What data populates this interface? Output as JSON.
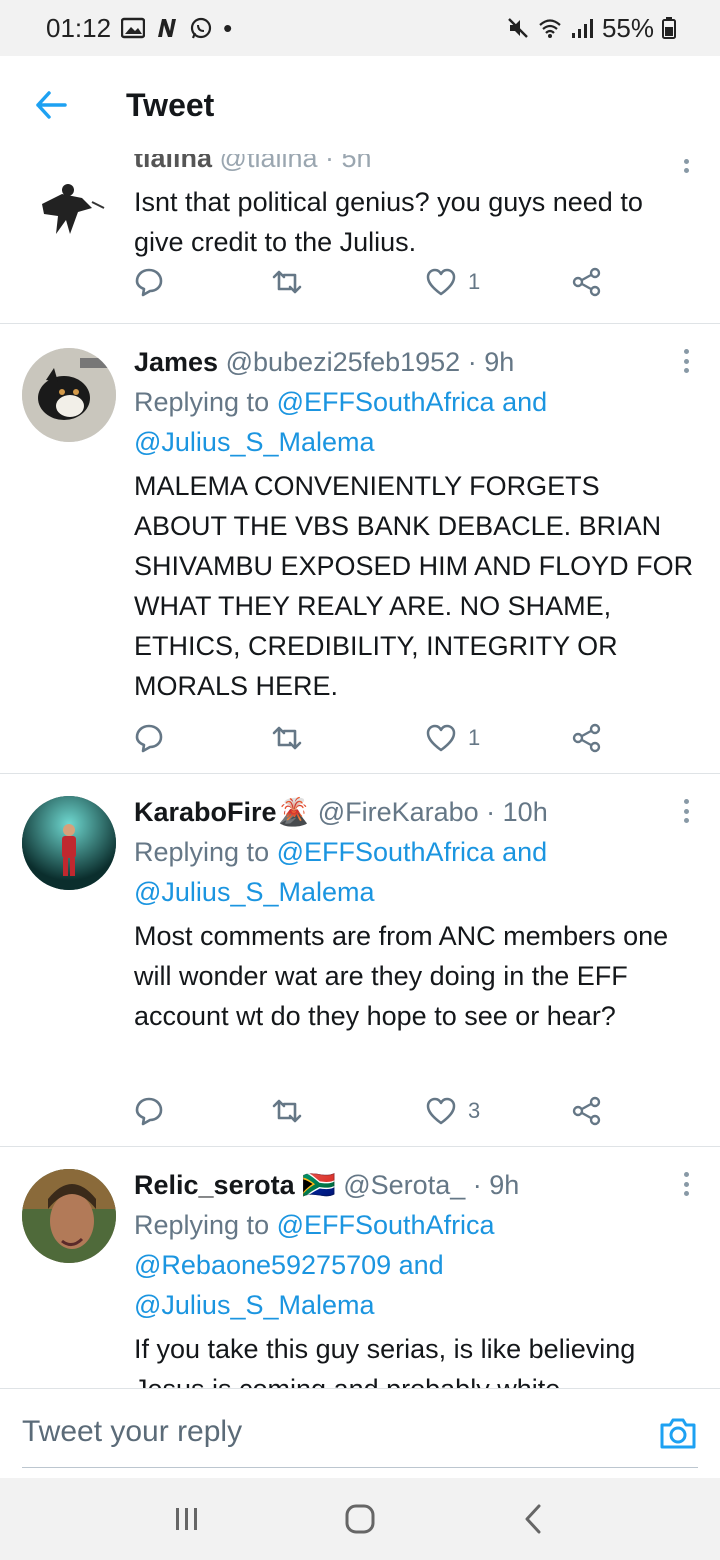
{
  "status_bar": {
    "time": "01:12",
    "dot": "•",
    "battery": "55%",
    "icons": [
      "gallery-icon",
      "n-icon",
      "whatsapp-icon",
      "mute-icon",
      "wifi-icon",
      "signal-icon",
      "battery-icon"
    ]
  },
  "header": {
    "title": "Tweet",
    "back_icon": "arrow-left-icon",
    "accent": "#1da1f2"
  },
  "tweets": [
    {
      "name": "tlallna",
      "handle": "@tlallna",
      "time": " · 5h",
      "text": "Isnt that political genius? you guys need to give credit to the Julius.",
      "likes": "1",
      "cut_off_top": true
    },
    {
      "name": "James",
      "handle": "@bubezi25feb1952",
      "time": " · 9h",
      "reply_prefix": "Replying to ",
      "reply_to_1": "@EFFSouthAfrica",
      "reply_joiner_1": " and",
      "reply_to_2": "@Julius_S_Malema",
      "text": "MALEMA CONVENIENTLY FORGETS ABOUT THE VBS BANK DEBACLE. BRIAN SHIVAMBU EXPOSED HIM AND FLOYD FOR WHAT THEY REALY ARE. NO SHAME, ETHICS, CREDIBILITY, INTEGRITY OR MORALS HERE.",
      "likes": "1"
    },
    {
      "name": "KaraboFire🌋",
      "handle": "@FireKarabo",
      "time": " · 10h",
      "reply_prefix": "Replying to ",
      "reply_to_1": "@EFFSouthAfrica",
      "reply_joiner_1": " and",
      "reply_to_2": "@Julius_S_Malema",
      "text": "Most comments are from ANC members one will wonder wat are they doing in the EFF account wt do they hope to see or hear?",
      "likes": "3"
    },
    {
      "name": "Relic_serota",
      "handle": "@Serota_",
      "time": " · 9h",
      "reply_prefix": "Replying to ",
      "reply_to_1": "@EFFSouthAfrica",
      "reply_to_2": "@Rebaone59275709",
      "reply_joiner_2": " and",
      "reply_to_3": "@Julius_S_Malema",
      "text": "If you take this guy serias, is like believing Jesus is coming and probably white",
      "flag": "🇿🇦"
    }
  ],
  "reply_bar": {
    "placeholder": "Tweet your reply",
    "camera_icon": "camera-icon"
  },
  "nav_bar": {
    "icons": [
      "recent-apps-icon",
      "home-icon",
      "back-icon"
    ]
  }
}
